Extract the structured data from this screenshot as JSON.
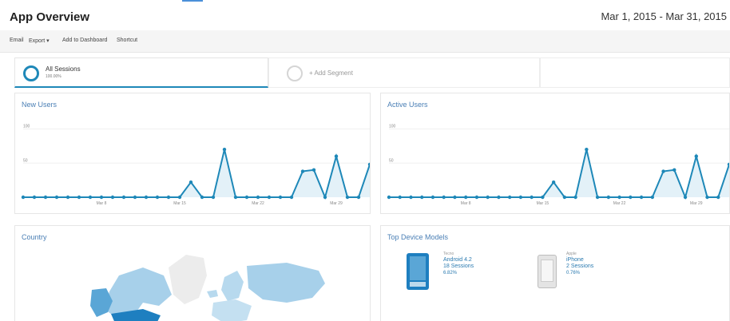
{
  "header": {
    "title": "App Overview",
    "date_range": "Mar 1, 2015 - Mar 31, 2015"
  },
  "toolbar": {
    "email": "Email",
    "export": "Export ▾",
    "add_to_dashboard": "Add to Dashboard",
    "shortcut": "Shortcut"
  },
  "segments": {
    "all_sessions": "All Sessions",
    "all_sessions_pct": "100.00%",
    "add_segment": "+ Add Segment"
  },
  "cards": {
    "new_users": "New Users",
    "active_users": "Active Users",
    "country": "Country",
    "top_devices": "Top Device Models"
  },
  "devices": [
    {
      "brand": "Tecno",
      "model": "Android 4.2",
      "sessions": "18 Sessions",
      "pct": "6.82%",
      "icon": "android-phone-icon"
    },
    {
      "brand": "Apple",
      "model": "iPhone",
      "sessions": "2 Sessions",
      "pct": "0.76%",
      "icon": "iphone-icon"
    }
  ],
  "colors": {
    "accent": "#1e88b8",
    "line": "#1e88b8",
    "fill": "#e3f1f8",
    "title_blue": "#4a7fb5"
  },
  "chart_data": [
    {
      "type": "area",
      "title": "New Users",
      "ytick_labels": [
        "100",
        "50"
      ],
      "yticks": [
        100,
        50
      ],
      "ylim": [
        0,
        110
      ],
      "xtick_labels": [
        "Mar 8",
        "Mar 15",
        "Mar 22",
        "Mar 29"
      ],
      "xtick_index": [
        7,
        14,
        21,
        28
      ],
      "series": [
        {
          "values": [
            0,
            0,
            0,
            0,
            0,
            0,
            0,
            0,
            0,
            0,
            0,
            0,
            0,
            0,
            0,
            22,
            0,
            0,
            70,
            0,
            0,
            0,
            0,
            0,
            0,
            38,
            40,
            0,
            60,
            0,
            0,
            48
          ]
        }
      ]
    },
    {
      "type": "area",
      "title": "Active Users",
      "ytick_labels": [
        "100",
        "50"
      ],
      "yticks": [
        100,
        50
      ],
      "ylim": [
        0,
        110
      ],
      "xtick_labels": [
        "Mar 8",
        "Mar 15",
        "Mar 22",
        "Mar 29"
      ],
      "xtick_index": [
        7,
        14,
        21,
        28
      ],
      "series": [
        {
          "values": [
            0,
            0,
            0,
            0,
            0,
            0,
            0,
            0,
            0,
            0,
            0,
            0,
            0,
            0,
            0,
            22,
            0,
            0,
            70,
            0,
            0,
            0,
            0,
            0,
            0,
            38,
            40,
            0,
            60,
            0,
            0,
            48
          ]
        }
      ]
    }
  ]
}
